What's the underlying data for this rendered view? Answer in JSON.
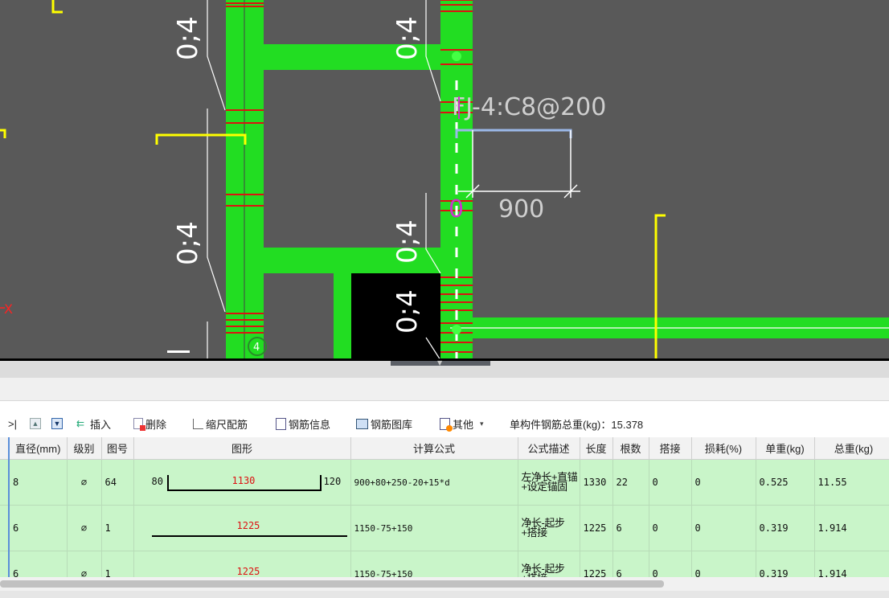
{
  "cad": {
    "labels": {
      "span_0_4": "0;4",
      "beam_tag": "FJ-4:C8@200",
      "dimension": "900",
      "axis_x": "X",
      "origin_marker": "0",
      "grid_bubble": "4"
    },
    "colors": {
      "background": "#595959",
      "rebar_body": "#22dd22",
      "stirrup": "#dd1111",
      "marker": "#ffff00"
    }
  },
  "toolbar": {
    "nav_prev": ">|",
    "insert": "插入",
    "delete": "删除",
    "scale_rebar": "缩尺配筋",
    "rebar_info": "钢筋信息",
    "rebar_library": "钢筋图库",
    "other": "其他",
    "total_weight_label": "单构件钢筋总重(kg)：15.378"
  },
  "table": {
    "columns": [
      "直径(mm)",
      "级别",
      "图号",
      "图形",
      "计算公式",
      "公式描述",
      "长度",
      "根数",
      "搭接",
      "损耗(%)",
      "单重(kg)",
      "总重(kg)"
    ],
    "rows": [
      {
        "diameter": "8",
        "grade": "⌀",
        "figure_no": "64",
        "shape_left": "80",
        "shape_main": "1130",
        "shape_right": "120",
        "formula": "900+80+250-20+15*d",
        "description": "左净长+直锚+设定锚固",
        "length": "1330",
        "count": "22",
        "lap": "0",
        "loss": "0",
        "unit_weight": "0.525",
        "total_weight": "11.55"
      },
      {
        "diameter": "6",
        "grade": "⌀",
        "figure_no": "1",
        "shape_main": "1225",
        "formula": "1150-75+150",
        "description": "净长-起步+搭接",
        "length": "1225",
        "count": "6",
        "lap": "0",
        "loss": "0",
        "unit_weight": "0.319",
        "total_weight": "1.914"
      },
      {
        "diameter": "6",
        "grade": "⌀",
        "figure_no": "1",
        "shape_main": "1225",
        "formula": "1150-75+150",
        "description": "净长-起步+搭接",
        "length": "1225",
        "count": "6",
        "lap": "0",
        "loss": "0",
        "unit_weight": "0.319",
        "total_weight": "1.914"
      }
    ]
  }
}
